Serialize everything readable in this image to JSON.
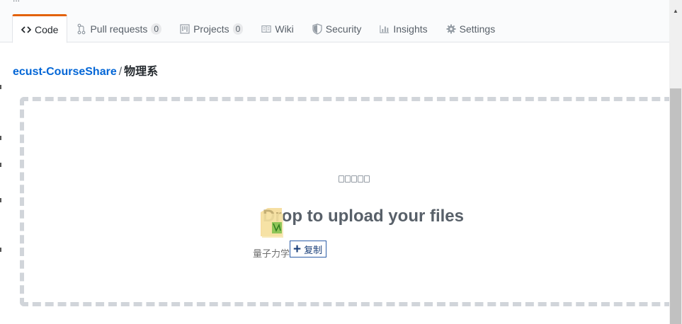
{
  "repo_nav": {
    "tabs": [
      {
        "label": "Code",
        "icon": "code-icon",
        "selected": true
      },
      {
        "label": "Pull requests",
        "icon": "git-pull-request-icon",
        "count": "0"
      },
      {
        "label": "Projects",
        "icon": "project-icon",
        "count": "0"
      },
      {
        "label": "Wiki",
        "icon": "book-icon"
      },
      {
        "label": "Security",
        "icon": "shield-icon"
      },
      {
        "label": "Insights",
        "icon": "graph-icon"
      },
      {
        "label": "Settings",
        "icon": "gear-icon"
      }
    ]
  },
  "breadcrumb": {
    "repo": "ecust-CourseShare",
    "separator": "/",
    "folder": "物理系"
  },
  "upload": {
    "drop_text": "Drop to upload your files"
  },
  "drag_ghost": {
    "label": "量子力学",
    "effect_label": "复制",
    "effect_icon": "plus-icon"
  },
  "colors": {
    "accent_tab_border": "#e36209",
    "link": "#0366d6",
    "dashed_border": "#d1d5da"
  }
}
